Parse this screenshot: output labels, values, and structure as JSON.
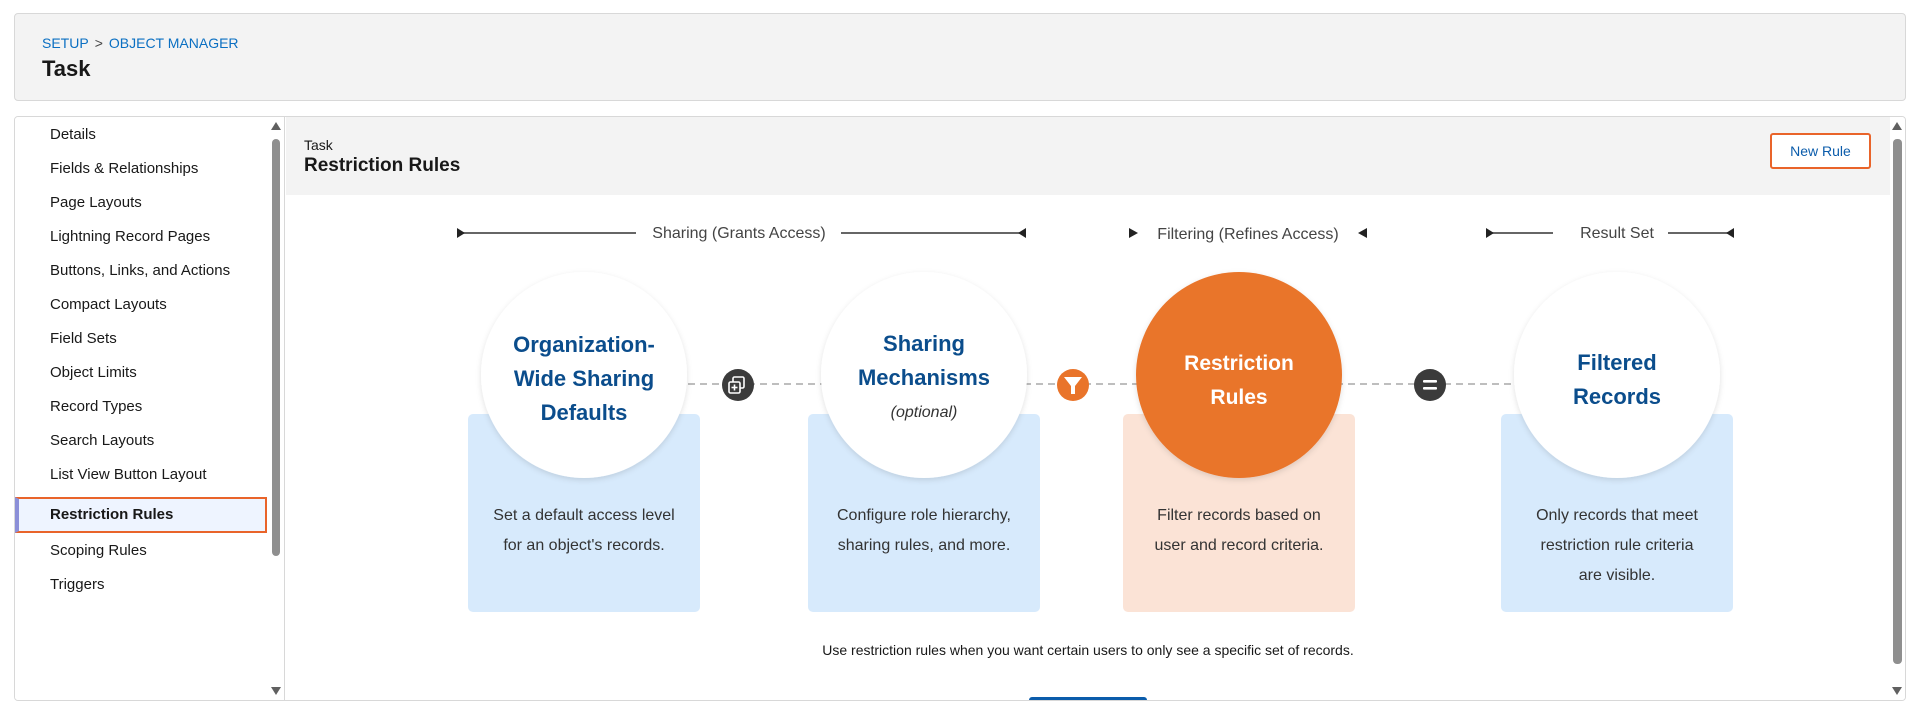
{
  "breadcrumb": {
    "setup": "SETUP",
    "separator": ">",
    "object_manager": "OBJECT MANAGER"
  },
  "page_title": "Task",
  "sidebar": {
    "items": [
      {
        "label": "Details"
      },
      {
        "label": "Fields & Relationships"
      },
      {
        "label": "Page Layouts"
      },
      {
        "label": "Lightning Record Pages"
      },
      {
        "label": "Buttons, Links, and Actions"
      },
      {
        "label": "Compact Layouts"
      },
      {
        "label": "Field Sets"
      },
      {
        "label": "Object Limits"
      },
      {
        "label": "Record Types"
      },
      {
        "label": "Search Layouts"
      },
      {
        "label": "List View Button Layout"
      },
      {
        "label": "Restriction Rules",
        "active": true
      },
      {
        "label": "Scoping Rules"
      },
      {
        "label": "Triggers"
      }
    ]
  },
  "main": {
    "object_label": "Task",
    "section_title": "Restriction Rules",
    "new_rule_label": "New Rule"
  },
  "diagram": {
    "sections": {
      "sharing": "Sharing (Grants Access)",
      "filtering": "Filtering (Refines Access)",
      "result": "Result Set"
    },
    "steps": [
      {
        "title_lines": [
          "Organization-",
          "Wide Sharing",
          "Defaults"
        ],
        "description_lines": [
          "Set a default access level",
          "for an object's records."
        ]
      },
      {
        "title_lines": [
          "Sharing",
          "Mechanisms"
        ],
        "optional": "(optional)",
        "description_lines": [
          "Configure role hierarchy,",
          "sharing rules, and more."
        ]
      },
      {
        "title_lines": [
          "Restriction",
          "Rules"
        ],
        "description_lines": [
          "Filter records based on",
          "user and record criteria."
        ]
      },
      {
        "title_lines": [
          "Filtered",
          "Records"
        ],
        "description_lines": [
          "Only records that meet",
          "restriction rule criteria",
          "are visible."
        ]
      }
    ],
    "connectors": [
      "plus-stack-icon",
      "filter-icon",
      "equals-icon"
    ]
  },
  "footnote": "Use restriction rules when you want certain users to only see a specific set of records.",
  "colors": {
    "brand_blue": "#0b5cab",
    "title_blue": "#0b4d8c",
    "accent_orange": "#e9742a",
    "highlight_border": "#e9642a",
    "light_blue_card": "#d7eafc",
    "light_orange_card": "#fbe3d6"
  }
}
